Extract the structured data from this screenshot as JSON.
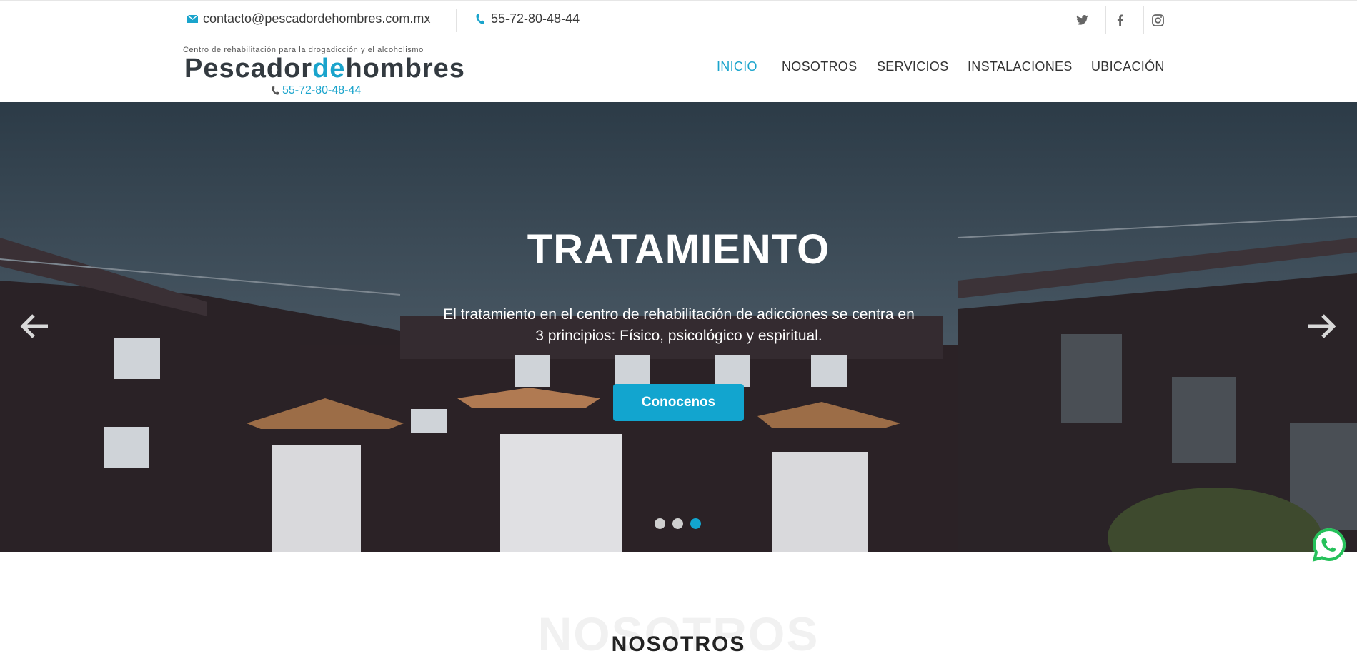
{
  "topbar": {
    "email": "contacto@pescadordehombres.com.mx",
    "phone": "55-72-80-48-44",
    "social": [
      "twitter-icon",
      "facebook-icon",
      "instagram-icon"
    ]
  },
  "header": {
    "tagline": "Centro de rehabilitación para la drogadicción y el alcoholismo",
    "logo_part1": "Pescador",
    "logo_part2": "de",
    "logo_part3": "hombres",
    "phone": "55-72-80-48-44",
    "nav": [
      "INICIO",
      "NOSOTROS",
      "SERVICIOS",
      "INSTALACIONES",
      "UBICACIÓN"
    ],
    "active_nav": "INICIO"
  },
  "hero": {
    "title": "TRATAMIENTO",
    "text": "El tratamiento en el centro de rehabilitación de adicciones se centra en 3 principios: Físico, psicológico y espiritual.",
    "button": "Conocenos",
    "slides_total": 3,
    "active_slide": 3
  },
  "section": {
    "background_title": "NOSOTROS",
    "title": "NOSOTROS"
  },
  "colors": {
    "accent": "#1aa4cc",
    "text": "#333a40"
  }
}
